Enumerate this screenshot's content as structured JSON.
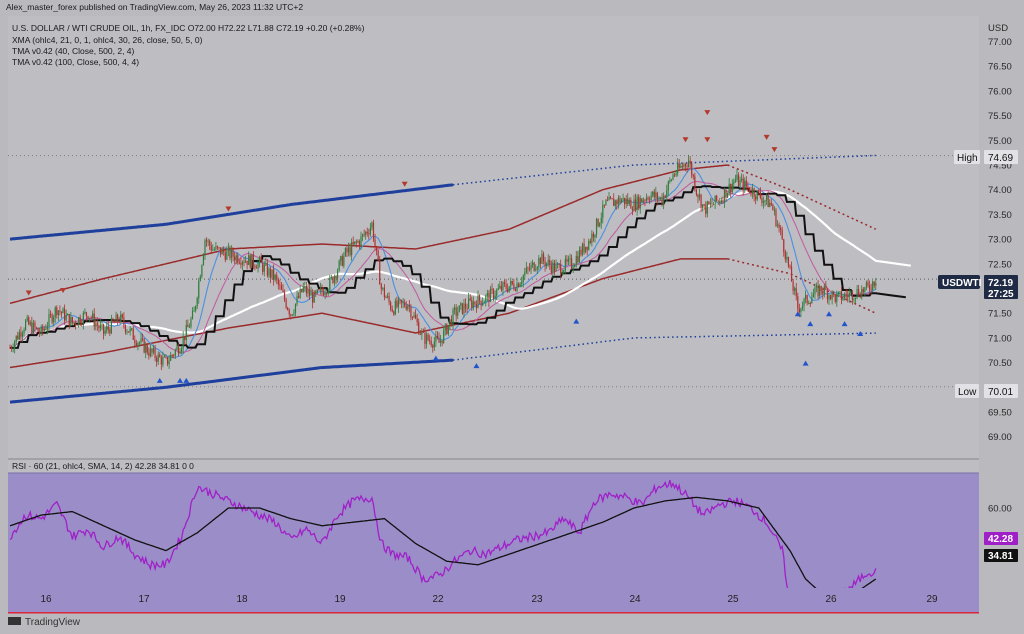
{
  "header": {
    "publisher": "Alex_master_forex published on TradingView.com, May 26, 2023 11:32 UTC+2",
    "symbol_line": "U.S. DOLLAR / WTI CRUDE OIL, 1h, FX_IDC O72.00 H72.22 L71.88 C72.19 +0.20 (+0.28%)",
    "indicators": [
      "XMA (ohlc4, 21, 0, 1, ohlc4, 30, 26, close, 50, 5, 0)",
      "TMA v0.42 (40, Close, 500, 2, 4)",
      "TMA v0.42 (100, Close, 500, 4, 4)"
    ]
  },
  "currency": "USD",
  "price_tag": {
    "label": "USDWTI",
    "price": "72.19",
    "countdown": "27:25"
  },
  "high": {
    "label": "High",
    "value": "74.69",
    "price": 74.69
  },
  "low": {
    "label": "Low",
    "value": "70.01",
    "price": 70.01
  },
  "rsi": {
    "label": "RSI · 60 (21, ohlc4, SMA, 14, 2)  42.28  34.81  0  0",
    "value_label": "42.28",
    "signal_label": "34.81",
    "upper_band": 60,
    "lower_band": 40
  },
  "brand": "TradingView",
  "colors": {
    "candle_up": "#2e7d3a",
    "candle_down": "#b0302e",
    "outer_band": "#1e3f9c",
    "inner_band": "#9a2a2a",
    "tma_midline": "#ffffff",
    "xma_line": "#111111",
    "fast_ma": "#4a90e2",
    "pink_ma": "#c15a9c",
    "rsi_line": "#a020c8",
    "rsi_signal": "#111111",
    "rsi_fill": "#9b8ec8",
    "rsi_lower_line": "#d9263a",
    "marker": "#b33a2a",
    "marker_up": "#2255cc",
    "price_tag_bg": "#1f2a44",
    "label_bg": "#e2e2e6"
  },
  "chart_data": {
    "type": "candlestick",
    "y_axis": {
      "ticks": [
        "77.00",
        "76.50",
        "76.00",
        "75.50",
        "75.00",
        "74.50",
        "74.00",
        "73.50",
        "73.00",
        "72.50",
        "72.00",
        "71.50",
        "71.00",
        "70.50",
        "70.00",
        "69.50",
        "69.00"
      ],
      "ylim": [
        68.7,
        77.2
      ]
    },
    "x_axis": {
      "ticks": [
        "16",
        "17",
        "18",
        "19",
        "22",
        "23",
        "24",
        "25",
        "26",
        "29"
      ]
    },
    "rsi_axis": {
      "ticks": [
        "60.00"
      ],
      "ylim": [
        28,
        69
      ]
    },
    "price_path_anchors": [
      [
        0,
        70.8
      ],
      [
        10,
        71.3
      ],
      [
        20,
        71.1
      ],
      [
        30,
        71.6
      ],
      [
        40,
        71.3
      ],
      [
        50,
        71.5
      ],
      [
        60,
        71.1
      ],
      [
        70,
        71.4
      ],
      [
        80,
        71.0
      ],
      [
        90,
        70.7
      ],
      [
        100,
        70.5
      ],
      [
        110,
        70.9
      ],
      [
        118,
        71.5
      ],
      [
        125,
        73.0
      ],
      [
        130,
        72.8
      ],
      [
        140,
        72.7
      ],
      [
        150,
        72.6
      ],
      [
        160,
        72.5
      ],
      [
        170,
        72.2
      ],
      [
        180,
        71.5
      ],
      [
        188,
        72.0
      ],
      [
        195,
        71.8
      ],
      [
        205,
        72.1
      ],
      [
        215,
        72.7
      ],
      [
        225,
        73.0
      ],
      [
        232,
        73.3
      ],
      [
        238,
        72.0
      ],
      [
        245,
        71.6
      ],
      [
        255,
        71.7
      ],
      [
        265,
        71.0
      ],
      [
        275,
        70.9
      ],
      [
        285,
        71.5
      ],
      [
        295,
        71.7
      ],
      [
        305,
        71.8
      ],
      [
        315,
        72.0
      ],
      [
        325,
        72.1
      ],
      [
        330,
        72.3
      ],
      [
        340,
        72.6
      ],
      [
        350,
        72.4
      ],
      [
        360,
        72.5
      ],
      [
        372,
        73.0
      ],
      [
        382,
        73.7
      ],
      [
        392,
        73.8
      ],
      [
        400,
        73.7
      ],
      [
        410,
        73.9
      ],
      [
        418,
        73.8
      ],
      [
        425,
        74.3
      ],
      [
        435,
        74.6
      ],
      [
        440,
        74.0
      ],
      [
        445,
        73.6
      ],
      [
        455,
        73.8
      ],
      [
        465,
        74.2
      ],
      [
        475,
        74.0
      ],
      [
        488,
        73.7
      ],
      [
        495,
        73.0
      ],
      [
        500,
        72.3
      ],
      [
        505,
        71.6
      ],
      [
        512,
        71.8
      ],
      [
        520,
        72.0
      ],
      [
        530,
        71.8
      ],
      [
        540,
        71.9
      ],
      [
        550,
        72.0
      ],
      [
        555,
        72.2
      ]
    ],
    "rsi_path_anchors": [
      [
        0,
        52
      ],
      [
        10,
        58
      ],
      [
        20,
        57
      ],
      [
        30,
        61
      ],
      [
        40,
        52
      ],
      [
        50,
        54
      ],
      [
        60,
        49
      ],
      [
        70,
        52
      ],
      [
        80,
        47
      ],
      [
        90,
        44
      ],
      [
        100,
        44
      ],
      [
        110,
        52
      ],
      [
        120,
        66
      ],
      [
        130,
        64
      ],
      [
        140,
        62
      ],
      [
        150,
        60
      ],
      [
        160,
        58
      ],
      [
        170,
        56
      ],
      [
        180,
        51
      ],
      [
        190,
        54
      ],
      [
        200,
        50
      ],
      [
        210,
        58
      ],
      [
        220,
        62
      ],
      [
        232,
        63
      ],
      [
        238,
        50
      ],
      [
        245,
        47
      ],
      [
        255,
        46
      ],
      [
        265,
        40
      ],
      [
        275,
        41
      ],
      [
        285,
        45
      ],
      [
        295,
        48
      ],
      [
        305,
        47
      ],
      [
        315,
        49
      ],
      [
        325,
        51
      ],
      [
        335,
        52
      ],
      [
        345,
        53
      ],
      [
        355,
        57
      ],
      [
        365,
        53
      ],
      [
        375,
        62
      ],
      [
        385,
        64
      ],
      [
        395,
        63
      ],
      [
        405,
        61
      ],
      [
        415,
        66
      ],
      [
        425,
        67
      ],
      [
        435,
        63
      ],
      [
        440,
        60
      ],
      [
        445,
        58
      ],
      [
        455,
        61
      ],
      [
        465,
        62
      ],
      [
        475,
        60
      ],
      [
        485,
        56
      ],
      [
        495,
        48
      ],
      [
        500,
        33
      ],
      [
        505,
        34
      ],
      [
        512,
        36
      ],
      [
        520,
        36
      ],
      [
        530,
        35
      ],
      [
        540,
        38
      ],
      [
        550,
        42
      ],
      [
        555,
        42
      ]
    ],
    "rsi_signal_anchors": [
      [
        0,
        55
      ],
      [
        20,
        58
      ],
      [
        40,
        59
      ],
      [
        60,
        55
      ],
      [
        80,
        51
      ],
      [
        100,
        48
      ],
      [
        120,
        53
      ],
      [
        140,
        60
      ],
      [
        160,
        60
      ],
      [
        180,
        57
      ],
      [
        200,
        55
      ],
      [
        220,
        56
      ],
      [
        240,
        57
      ],
      [
        260,
        50
      ],
      [
        280,
        45
      ],
      [
        300,
        44
      ],
      [
        320,
        47
      ],
      [
        340,
        50
      ],
      [
        360,
        53
      ],
      [
        380,
        56
      ],
      [
        400,
        60
      ],
      [
        420,
        62
      ],
      [
        440,
        63
      ],
      [
        460,
        62
      ],
      [
        480,
        60
      ],
      [
        500,
        48
      ],
      [
        510,
        40
      ],
      [
        520,
        36
      ],
      [
        530,
        35
      ],
      [
        545,
        37
      ],
      [
        555,
        40
      ]
    ]
  }
}
